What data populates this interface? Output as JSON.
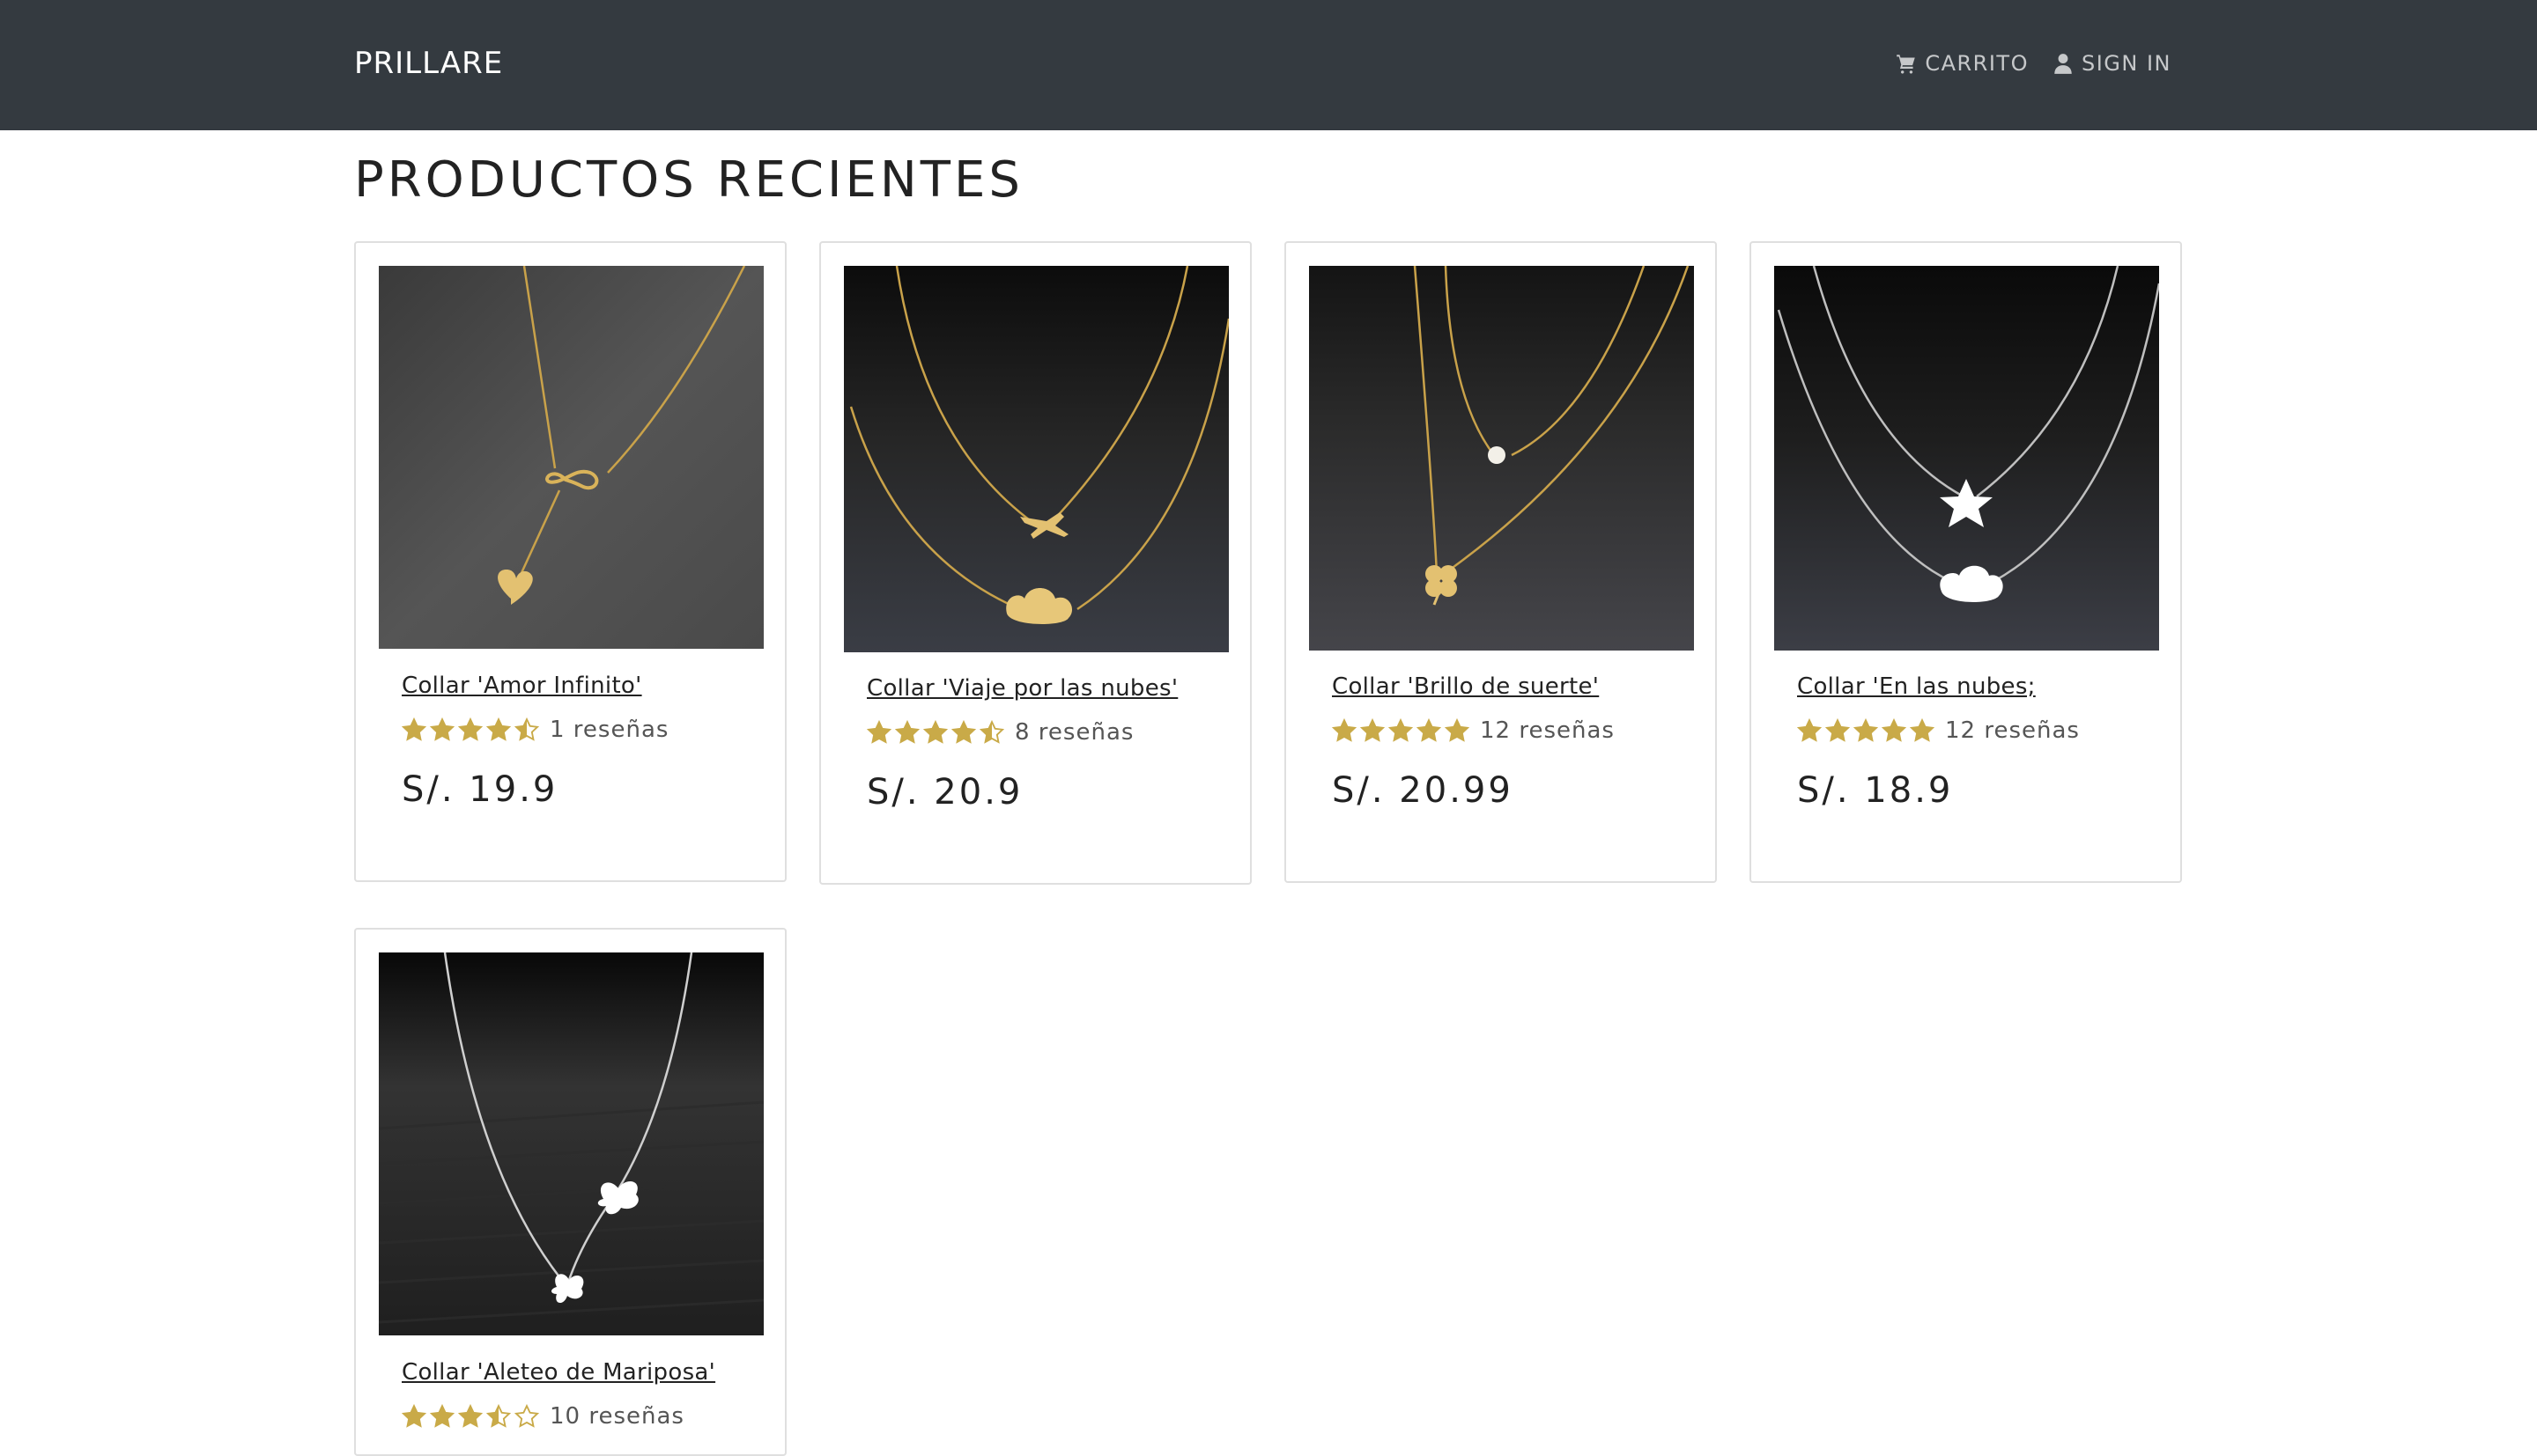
{
  "navbar": {
    "brand": "PRILLARE",
    "cart_label": "CARRITO",
    "signin_label": "SIGN IN"
  },
  "heading": "PRODUCTOS RECIENTES",
  "colors": {
    "navbar_bg": "#343a40",
    "star": "#c9aa48",
    "text": "#212529"
  },
  "products": [
    {
      "name": "Collar 'Amor Infinito'",
      "rating": 4.5,
      "reviews": "1 reseñas",
      "price": "S/. 19.9",
      "image": "gold-infinity-heart-necklace"
    },
    {
      "name": "Collar 'Viaje por las nubes'",
      "rating": 4.5,
      "reviews": "8 reseñas",
      "price": "S/. 20.9",
      "image": "gold-airplane-cloud-necklace"
    },
    {
      "name": "Collar 'Brillo de suerte'",
      "rating": 5,
      "reviews": "12 reseñas",
      "price": "S/. 20.99",
      "image": "gold-pearl-clover-necklace"
    },
    {
      "name": "Collar 'En las nubes;",
      "rating": 5,
      "reviews": "12 reseñas",
      "price": "S/. 18.9",
      "image": "silver-star-cloud-necklace"
    },
    {
      "name": "Collar 'Aleteo de Mariposa'",
      "rating": 3.5,
      "reviews": "10 reseñas",
      "price": "",
      "image": "silver-butterfly-necklace"
    }
  ]
}
